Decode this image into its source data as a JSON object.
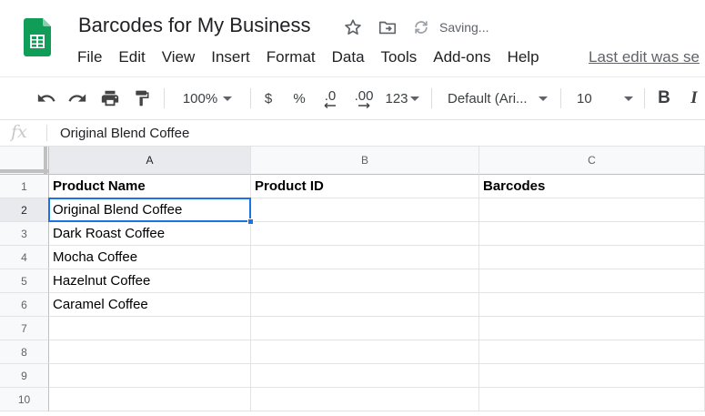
{
  "app": {
    "title": "Barcodes for My Business",
    "status": "Saving...",
    "last_edit": "Last edit was se",
    "colors": {
      "logo_green": "#0f9d58",
      "selection_blue": "#1a73e8"
    }
  },
  "title_icons": [
    "star-icon",
    "move-to-folder-icon",
    "sync-icon"
  ],
  "menu": [
    "File",
    "Edit",
    "View",
    "Insert",
    "Format",
    "Data",
    "Tools",
    "Add-ons",
    "Help"
  ],
  "toolbar": {
    "zoom": "100%",
    "currency": "$",
    "percent": "%",
    "decrease_decimal": ".0",
    "increase_decimal": ".00",
    "more_formats": "123",
    "font": "Default (Ari...",
    "font_size": "10",
    "bold": "B",
    "italic": "I"
  },
  "formula_bar": {
    "label": "fx",
    "content": "Original Blend Coffee"
  },
  "sheet": {
    "columns": [
      "A",
      "B",
      "C"
    ],
    "rows": [
      "1",
      "2",
      "3",
      "4",
      "5",
      "6",
      "7",
      "8",
      "9",
      "10"
    ],
    "selected_cell": "A2",
    "cells": [
      [
        "Product Name",
        "Product ID",
        "Barcodes"
      ],
      [
        "Original Blend Coffee",
        "",
        ""
      ],
      [
        "Dark Roast Coffee",
        "",
        ""
      ],
      [
        "Mocha Coffee",
        "",
        ""
      ],
      [
        "Hazelnut Coffee",
        "",
        ""
      ],
      [
        "Caramel Coffee",
        "",
        ""
      ],
      [
        "",
        "",
        ""
      ],
      [
        "",
        "",
        ""
      ],
      [
        "",
        "",
        ""
      ],
      [
        "",
        "",
        ""
      ]
    ]
  }
}
